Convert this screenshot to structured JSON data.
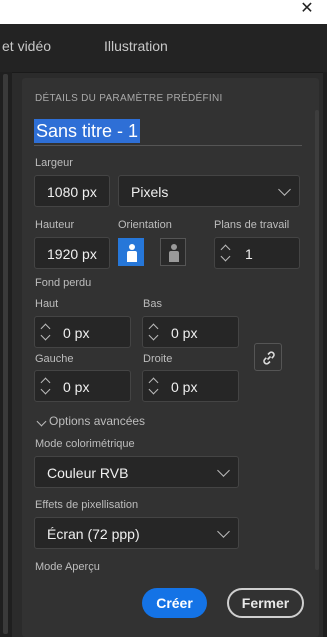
{
  "window": {
    "close_glyph": "✕"
  },
  "tabs": [
    {
      "label": "et vidéo"
    },
    {
      "label": "Illustration"
    }
  ],
  "section": {
    "title": "DÉTAILS DU PARAMÈTRE PRÉDÉFINI"
  },
  "preset": {
    "name": "Sans titre - 1"
  },
  "width": {
    "label": "Largeur",
    "value": "1080 px",
    "unit": "Pixels"
  },
  "height": {
    "label": "Hauteur",
    "value": "1920 px"
  },
  "orientation": {
    "label": "Orientation",
    "selected": "portrait"
  },
  "artboards": {
    "label": "Plans de travail",
    "value": "1"
  },
  "bleed": {
    "label": "Fond perdu",
    "top": {
      "label": "Haut",
      "value": "0 px"
    },
    "bottom": {
      "label": "Bas",
      "value": "0 px"
    },
    "left": {
      "label": "Gauche",
      "value": "0 px"
    },
    "right": {
      "label": "Droite",
      "value": "0 px"
    },
    "link_icon": "link-icon"
  },
  "advanced": {
    "label": "Options avancées"
  },
  "color_mode": {
    "label": "Mode colorimétrique",
    "value": "Couleur RVB"
  },
  "raster": {
    "label": "Effets de pixellisation",
    "value": "Écran (72 ppp)"
  },
  "preview": {
    "label": "Mode Aperçu"
  },
  "buttons": {
    "create": "Créer",
    "close": "Fermer"
  },
  "colors": {
    "accent": "#1473e6",
    "selection": "#2e6fd6",
    "panel": "#323232"
  }
}
